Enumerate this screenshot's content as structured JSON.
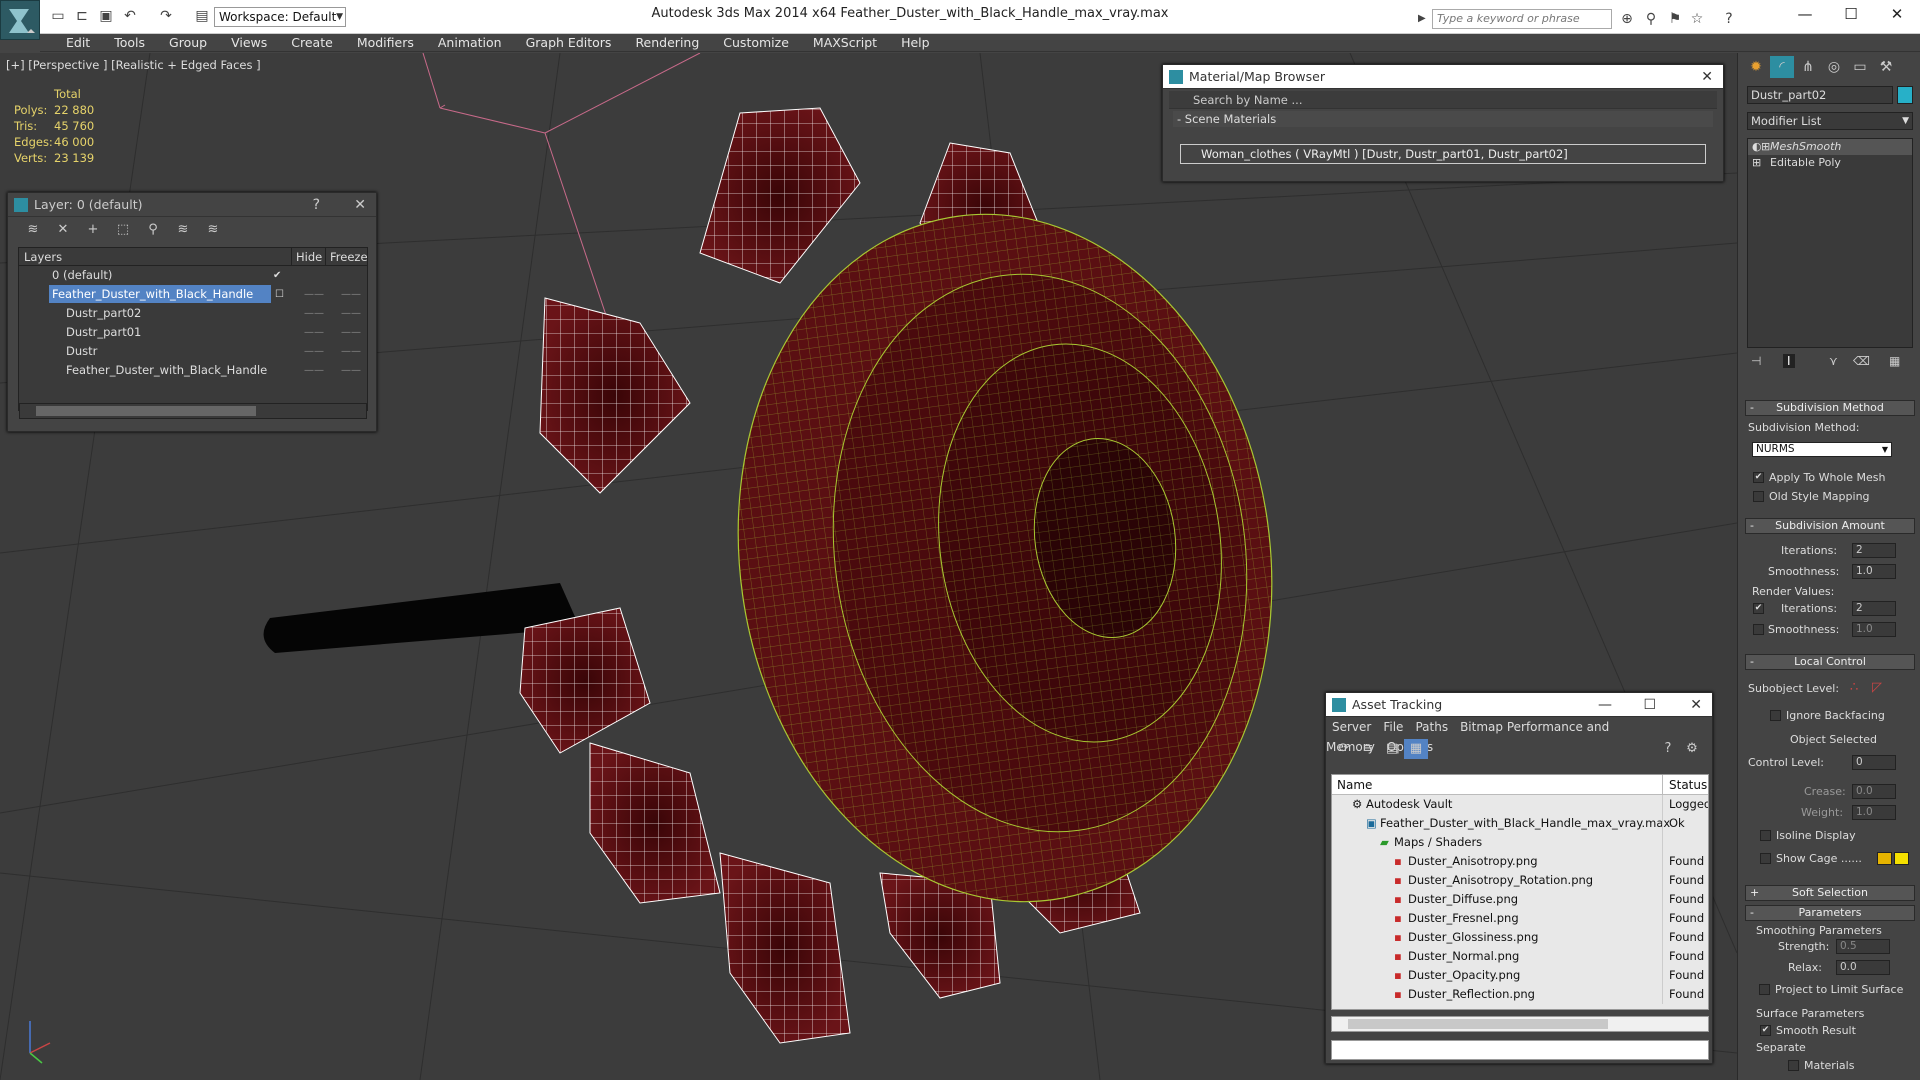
{
  "titlebar": {
    "workspace": "Workspace: Default",
    "app_title": "Autodesk 3ds Max  2014 x64      Feather_Duster_with_Black_Handle_max_vray.max",
    "search_placeholder": "Type a keyword or phrase"
  },
  "menu": [
    "Edit",
    "Tools",
    "Group",
    "Views",
    "Create",
    "Modifiers",
    "Animation",
    "Graph Editors",
    "Rendering",
    "Customize",
    "MAXScript",
    "Help"
  ],
  "viewport": {
    "label": "[+] [Perspective ] [Realistic + Edged Faces ]",
    "stats": {
      "header": "Total",
      "rows": [
        {
          "label": "Polys:",
          "value": "22 880"
        },
        {
          "label": "Tris:",
          "value": "45 760"
        },
        {
          "label": "Edges:",
          "value": "46 000"
        },
        {
          "label": "Verts:",
          "value": "23 139"
        }
      ]
    },
    "mesh_colors": {
      "background": "#3c3c3c",
      "wire_white": "#ffffff",
      "wire_green": "#a8c832",
      "face": "#5a0f12"
    }
  },
  "layer_panel": {
    "title": "Layer: 0 (default)",
    "help": "?",
    "columns": {
      "layers": "Layers",
      "hide": "Hide",
      "freeze": "Freeze"
    },
    "rows": [
      {
        "name": "0 (default)"
      },
      {
        "name": "Feather_Duster_with_Black_Handle"
      },
      {
        "name": "Dustr_part02"
      },
      {
        "name": "Dustr_part01"
      },
      {
        "name": "Dustr"
      },
      {
        "name": "Feather_Duster_with_Black_Handle"
      }
    ]
  },
  "material_browser": {
    "title": "Material/Map Browser",
    "search_placeholder": "Search by Name ...",
    "section": "- Scene Materials",
    "item": "Woman_clothes  ( VRayMtl )  [Dustr, Dustr_part01, Dustr_part02]"
  },
  "asset_tracking": {
    "title": "Asset Tracking",
    "menu": [
      "Server",
      "File",
      "Paths",
      "Bitmap Performance and Memory",
      "Options"
    ],
    "columns": {
      "name": "Name",
      "status": "Status"
    },
    "rows": [
      {
        "name": "Autodesk Vault",
        "status": "Logged"
      },
      {
        "name": "Feather_Duster_with_Black_Handle_max_vray.max",
        "status": "Ok"
      },
      {
        "name": "Maps / Shaders",
        "status": ""
      },
      {
        "name": "Duster_Anisotropy.png",
        "status": "Found"
      },
      {
        "name": "Duster_Anisotropy_Rotation.png",
        "status": "Found"
      },
      {
        "name": "Duster_Diffuse.png",
        "status": "Found"
      },
      {
        "name": "Duster_Fresnel.png",
        "status": "Found"
      },
      {
        "name": "Duster_Glossiness.png",
        "status": "Found"
      },
      {
        "name": "Duster_Normal.png",
        "status": "Found"
      },
      {
        "name": "Duster_Opacity.png",
        "status": "Found"
      },
      {
        "name": "Duster_Reflection.png",
        "status": "Found"
      }
    ]
  },
  "command_panel": {
    "object_name": "Dustr_part02",
    "object_color": "#27b0c8",
    "modifier_list": "Modifier List",
    "stack": [
      "MeshSmooth",
      "Editable Poly"
    ],
    "subdivision_method": {
      "rollout": "Subdivision Method",
      "label": "Subdivision Method:",
      "value": "NURMS",
      "apply_whole_mesh": "Apply To Whole Mesh",
      "old_style_mapping": "Old Style Mapping"
    },
    "subdivision_amount": {
      "rollout": "Subdivision Amount",
      "iterations_label": "Iterations:",
      "iterations": "2",
      "smoothness_label": "Smoothness:",
      "smoothness": "1.0",
      "render_values": "Render Values:",
      "render_iterations": "2",
      "render_smoothness": "1.0"
    },
    "local_control": {
      "rollout": "Local Control",
      "subobject_level": "Subobject Level:",
      "ignore_backfacing": "Ignore Backfacing",
      "object_selected": "Object Selected",
      "control_level_label": "Control Level:",
      "control_level": "0",
      "crease_label": "Crease:",
      "crease": "0.0",
      "weight_label": "Weight:",
      "weight": "1.0",
      "isoline_display": "Isoline Display",
      "show_cage": "Show Cage ......"
    },
    "soft_selection": {
      "rollout": "Soft Selection"
    },
    "parameters": {
      "rollout": "Parameters",
      "smoothing_group": "Smoothing Parameters",
      "strength_label": "Strength:",
      "strength": "0.5",
      "relax_label": "Relax:",
      "relax": "0.0",
      "project_limit": "Project to Limit Surface",
      "surface_group": "Surface Parameters",
      "smooth_result": "Smooth Result",
      "separate": "Separate",
      "materials": "Materials"
    }
  }
}
